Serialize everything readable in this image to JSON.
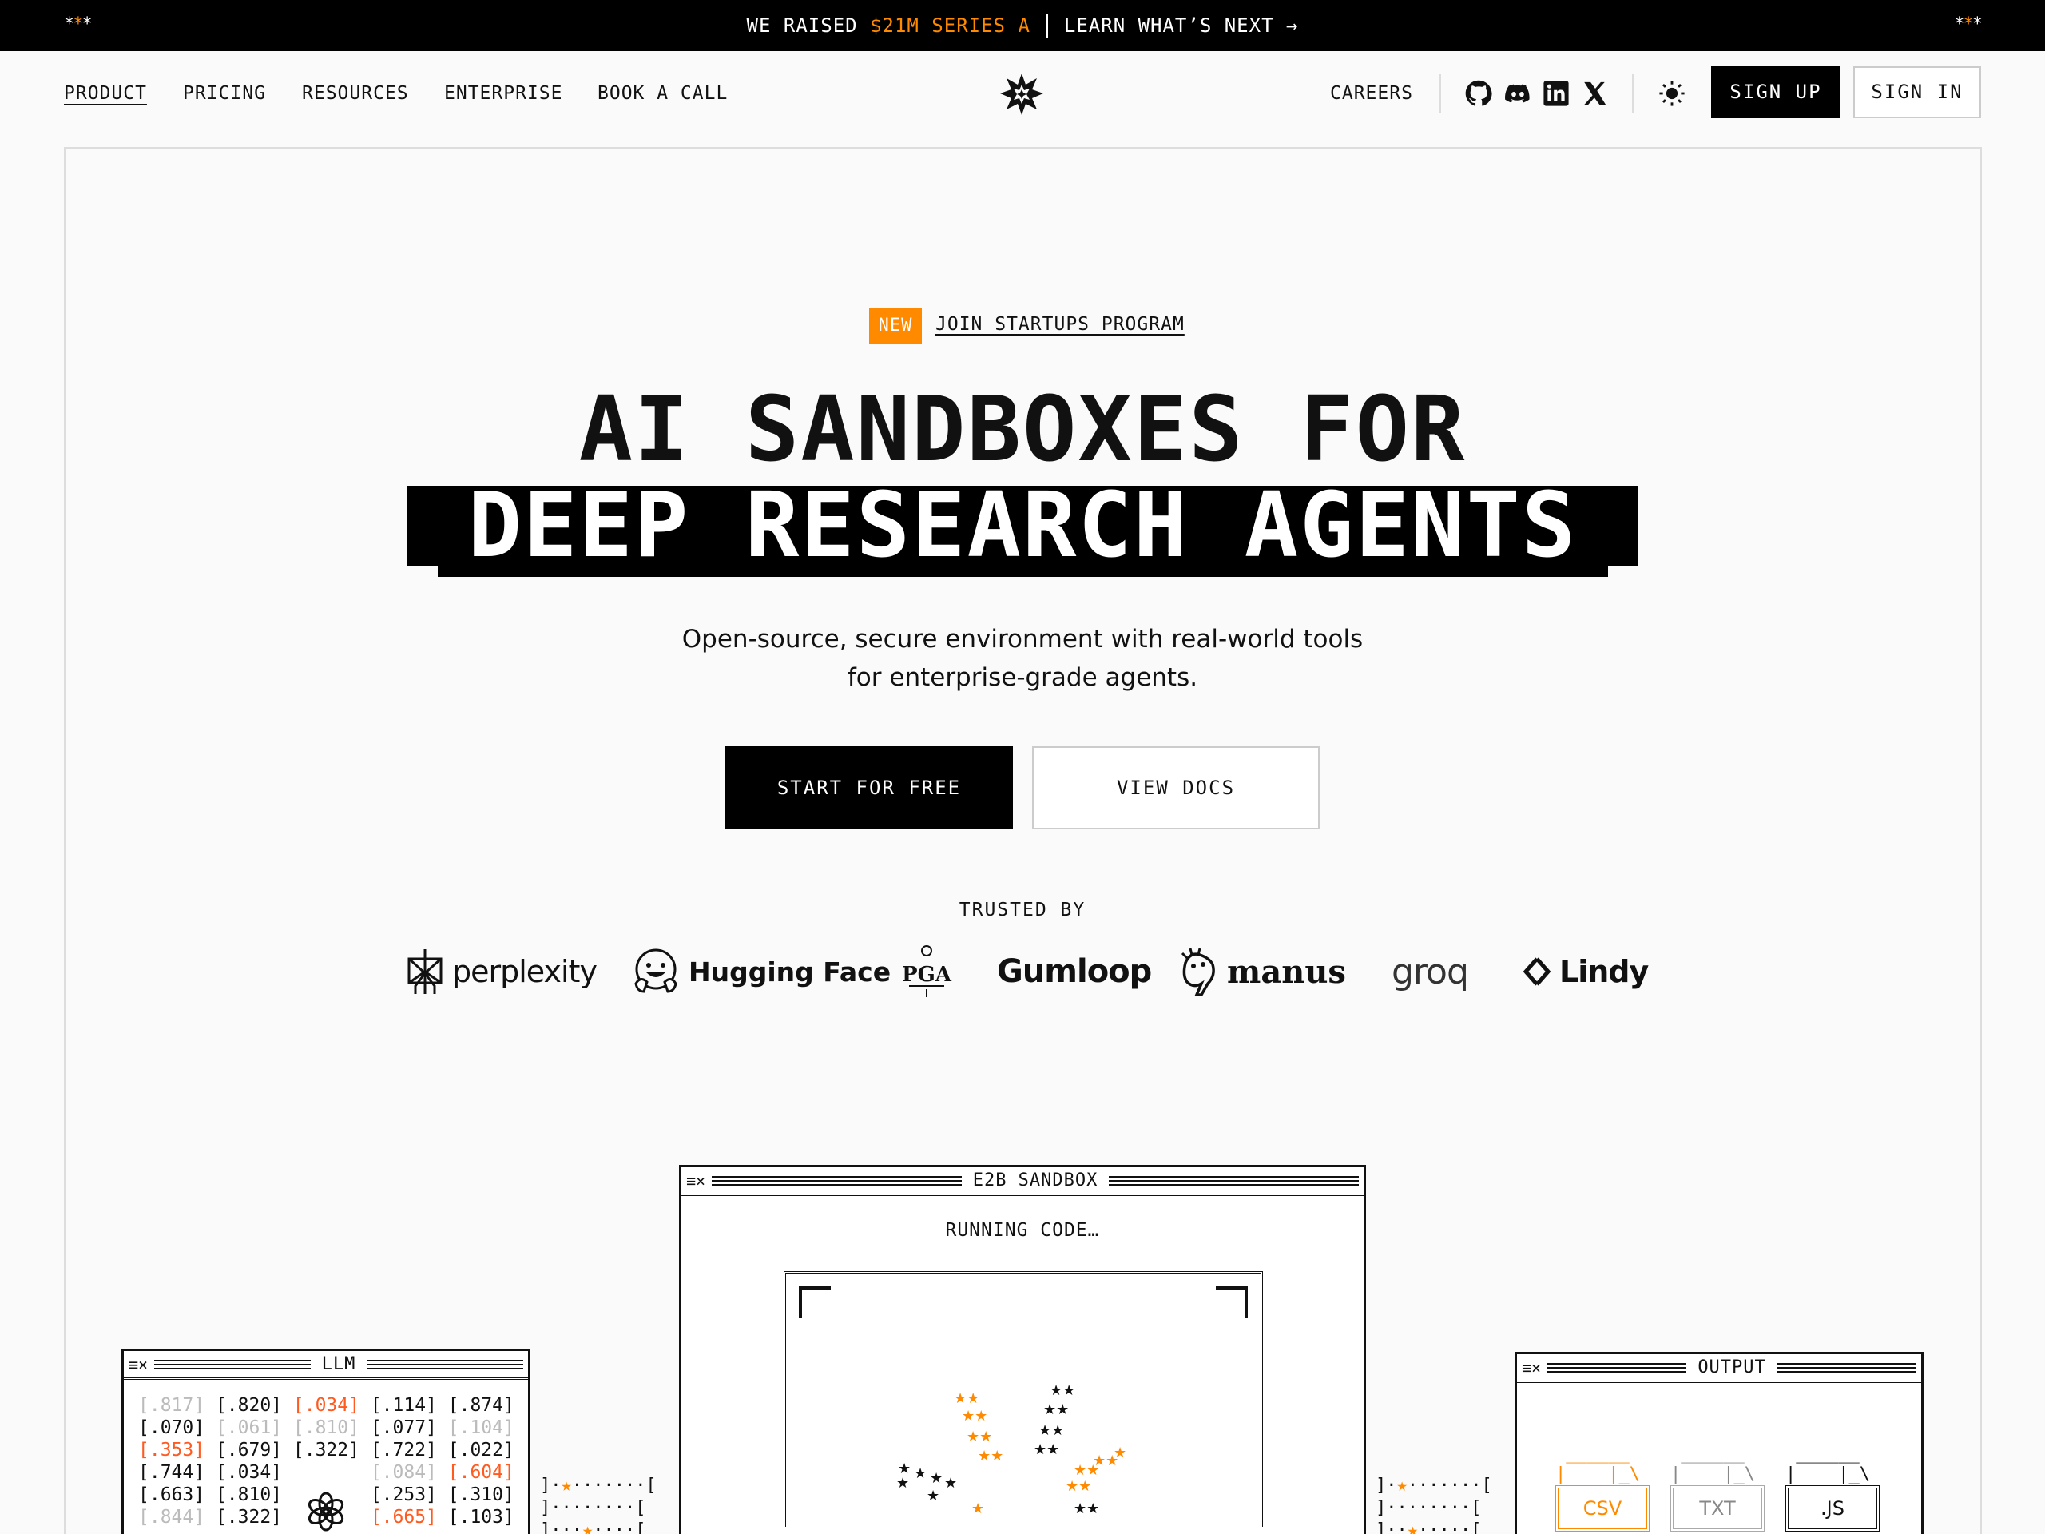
{
  "announcement": {
    "left_stars": "***",
    "right_stars": "***",
    "raised_prefix": "WE RAISED",
    "raised_amount": "$21M SERIES A",
    "cta": "LEARN WHAT’S NEXT →"
  },
  "nav": {
    "left_links": [
      "PRODUCT",
      "PRICING",
      "RESOURCES",
      "ENTERPRISE",
      "BOOK A CALL"
    ],
    "careers": "CAREERS",
    "social_icons": [
      "github-icon",
      "discord-icon",
      "linkedin-icon",
      "x-icon"
    ],
    "theme_icon": "sun-icon",
    "sign_up": "SIGN UP",
    "sign_in": "SIGN IN"
  },
  "hero": {
    "badge": "NEW",
    "badge_link": "JOIN STARTUPS PROGRAM",
    "headline_line1": "AI SANDBOXES FOR",
    "headline_line2": "DEEP RESEARCH AGENTS",
    "subtitle_line1": "Open-source, secure environment with real-world tools",
    "subtitle_line2": "for enterprise-grade agents.",
    "primary_cta": "START FOR FREE",
    "secondary_cta": "VIEW DOCS"
  },
  "trusted": {
    "label": "TRUSTED BY",
    "logos": [
      "perplexity",
      "Hugging Face",
      "PGA",
      "Gumloop",
      "manus",
      "groq",
      "Lindy"
    ]
  },
  "windows": {
    "llm": {
      "title": "LLM",
      "rows": [
        [
          ".817",
          ".820",
          ".034",
          ".114",
          ".874"
        ],
        [
          ".070",
          ".061",
          ".810",
          ".077",
          ".104"
        ],
        [
          ".353",
          ".679",
          ".322",
          ".722",
          ".022"
        ],
        [
          ".744",
          ".034",
          "",
          ".084",
          ".604"
        ],
        [
          ".663",
          ".810",
          "",
          ".253",
          ".310"
        ],
        [
          ".844",
          ".322",
          "",
          ".665",
          ".103"
        ]
      ]
    },
    "sandbox": {
      "title": "E2B SANDBOX",
      "status": "RUNNING CODE…"
    },
    "output": {
      "title": "OUTPUT",
      "files": [
        "CSV",
        "TXT",
        ".JS"
      ]
    }
  },
  "colors": {
    "accent": "#ff8a00",
    "accent_red": "#ff5a1f",
    "ink": "#111111",
    "background": "#fafafa"
  }
}
